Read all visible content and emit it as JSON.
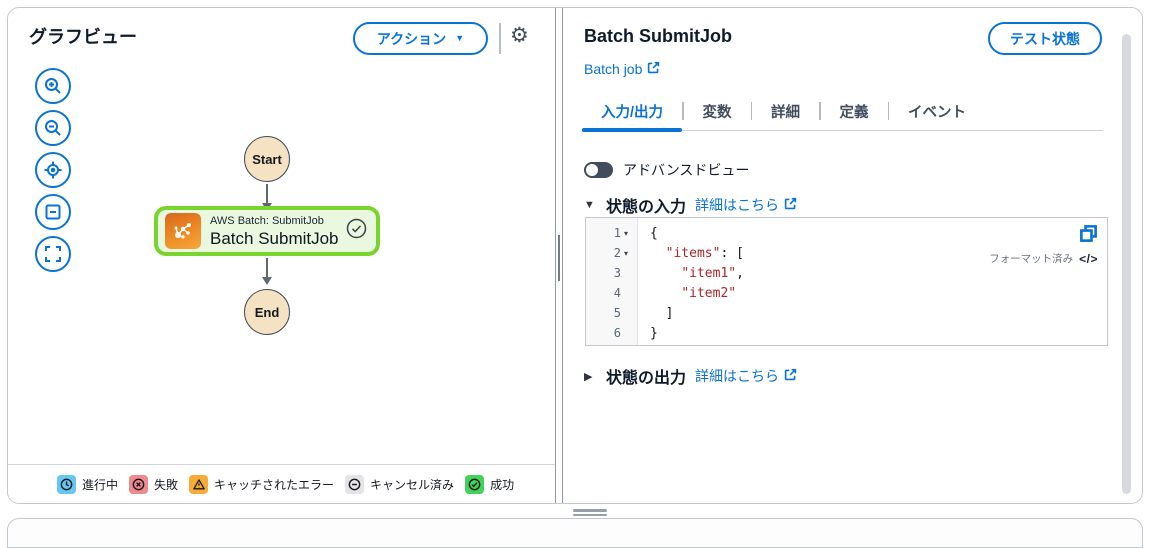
{
  "icons": {
    "caret_down": "▼",
    "caret_right": "▶",
    "fold_caret": "▾",
    "gear": "⚙",
    "code_toggle": "</>"
  },
  "colors": {
    "accent_blue": "#0972d3",
    "selected_node_border": "#79d42e",
    "selected_node_fill": "#e9f8de",
    "start_end_fill": "#f5e2c3",
    "batch_icon_orange": "#ee8b24",
    "toggle_off": "#414d5c",
    "code_string_red": "#a8262c",
    "legend_in_progress": "#66c7f0",
    "legend_failed": "#f0898d",
    "legend_caught_error": "#f8ab36",
    "legend_canceled": "#e4e4e7",
    "legend_succeeded": "#43d159"
  },
  "left_panel": {
    "title": "グラフビュー",
    "actions_button_label": "アクション",
    "graph": {
      "start_label": "Start",
      "node_service_label": "AWS Batch: SubmitJob",
      "node_title": "Batch SubmitJob",
      "end_label": "End"
    },
    "legend": {
      "in_progress": "進行中",
      "failed": "失敗",
      "caught_error": "キャッチされたエラー",
      "canceled": "キャンセル済み",
      "succeeded": "成功"
    }
  },
  "right_panel": {
    "title": "Batch SubmitJob",
    "resource_link_label": "Batch job",
    "test_state_button_label": "テスト状態",
    "tabs": [
      {
        "label": "入力/出力",
        "active": true
      },
      {
        "label": "変数",
        "active": false
      },
      {
        "label": "詳細",
        "active": false
      },
      {
        "label": "定義",
        "active": false
      },
      {
        "label": "イベント",
        "active": false
      }
    ],
    "advanced_view_label": "アドバンスドビュー",
    "state_input_label": "状態の入力",
    "state_output_label": "状態の出力",
    "details_link_label": "詳細はこちら",
    "code": {
      "formatted_badge": "フォーマット済み",
      "lines": [
        {
          "n": "1",
          "caret": true,
          "segs": [
            {
              "t": "{",
              "c": "p"
            }
          ]
        },
        {
          "n": "2",
          "caret": true,
          "segs": [
            {
              "t": "  ",
              "c": "p"
            },
            {
              "t": "\"items\"",
              "c": "s"
            },
            {
              "t": ": [",
              "c": "p"
            }
          ]
        },
        {
          "n": "3",
          "caret": false,
          "segs": [
            {
              "t": "    ",
              "c": "p"
            },
            {
              "t": "\"item1\"",
              "c": "s"
            },
            {
              "t": ",",
              "c": "p"
            }
          ]
        },
        {
          "n": "4",
          "caret": false,
          "segs": [
            {
              "t": "    ",
              "c": "p"
            },
            {
              "t": "\"item2\"",
              "c": "s"
            }
          ]
        },
        {
          "n": "5",
          "caret": false,
          "segs": [
            {
              "t": "  ]",
              "c": "p"
            }
          ]
        },
        {
          "n": "6",
          "caret": false,
          "segs": [
            {
              "t": "}",
              "c": "p"
            }
          ]
        }
      ]
    }
  }
}
